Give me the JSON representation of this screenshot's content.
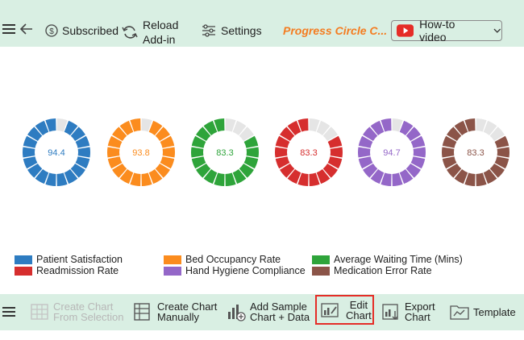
{
  "toolbar": {
    "subscribed_label": "Subscribed",
    "reload_label_1": "Reload",
    "reload_label_2": "Add-in",
    "settings_label": "Settings",
    "chart_title": "Progress Circle C...",
    "howto_label": "How-to video"
  },
  "colors": {
    "accent_orange": "#f47c20",
    "toolbar_bg": "#d9efe3",
    "youtube_red": "#e52d27",
    "edit_highlight": "#e52d27"
  },
  "chart_data": {
    "type": "progress-circle",
    "series": [
      {
        "name": "Patient Satisfaction",
        "value": 94.4,
        "color": "#2e7cc1"
      },
      {
        "name": "Bed Occupancy Rate",
        "value": 93.8,
        "color": "#fb8c1e"
      },
      {
        "name": "Average Waiting Time (Mins)",
        "value": 83.3,
        "color": "#2ea43a"
      },
      {
        "name": "Readmission Rate",
        "value": 83.3,
        "color": "#d62e2e"
      },
      {
        "name": "Hand Hygiene Compliance",
        "value": 94.7,
        "color": "#9467c8"
      },
      {
        "name": "Medication Error Rate",
        "value": 83.3,
        "color": "#8b5448"
      }
    ],
    "max": 100,
    "segments": 18,
    "remainder_color": "#e5e5e5"
  },
  "bottombar": {
    "create_selection_1": "Create Chart",
    "create_selection_2": "From Selection",
    "create_manual_1": "Create Chart",
    "create_manual_2": "Manually",
    "add_sample_1": "Add Sample",
    "add_sample_2": "Chart + Data",
    "edit_1": "Edit",
    "edit_2": "Chart",
    "export_1": "Export",
    "export_2": "Chart",
    "template_label": "Template"
  }
}
